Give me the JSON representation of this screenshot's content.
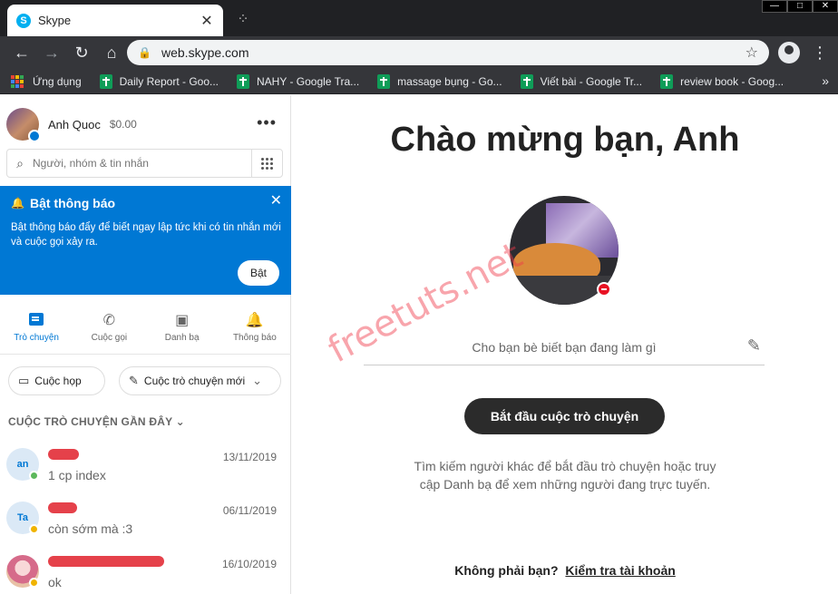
{
  "browser": {
    "tab_title": "Skype",
    "tab_favicon_letter": "S",
    "url": "web.skype.com",
    "bookmarks": [
      {
        "label": "Ứng dụng",
        "icon": "apps-grid-icon"
      },
      {
        "label": "Daily Report - Goo...",
        "icon": "google-sheets-icon"
      },
      {
        "label": "NAHY - Google Tra...",
        "icon": "google-sheets-icon"
      },
      {
        "label": "massage bụng - Go...",
        "icon": "google-sheets-icon"
      },
      {
        "label": "Viết bài - Google Tr...",
        "icon": "google-sheets-icon"
      },
      {
        "label": "review book - Goog...",
        "icon": "google-sheets-icon"
      }
    ],
    "bookmarks_more": "»"
  },
  "sidebar": {
    "profile": {
      "name": "Anh Quoc",
      "credit": "$0.00"
    },
    "search_placeholder": "Người, nhóm & tin nhắn",
    "notification": {
      "title": "Bật thông báo",
      "body": "Bật thông báo đẩy để biết ngay lập tức khi có tin nhắn mới và cuộc gọi xảy ra.",
      "button": "Bật"
    },
    "tabs": [
      {
        "label": "Trò chuyện",
        "icon": "chat-icon",
        "active": true
      },
      {
        "label": "Cuộc gọi",
        "icon": "phone-icon",
        "active": false
      },
      {
        "label": "Danh bạ",
        "icon": "contacts-icon",
        "active": false
      },
      {
        "label": "Thông báo",
        "icon": "bell-icon",
        "active": false
      }
    ],
    "meet_button": "Cuộc họp",
    "new_chat_button": "Cuộc trò chuyện mới",
    "recent_title": "CUỘC TRÒ CHUYỆN GẦN ĐÂY",
    "chats": [
      {
        "initials": "an",
        "message": "1 cp index",
        "date": "13/11/2019",
        "status_color": "#5cb85c"
      },
      {
        "initials": "Ta",
        "message": "còn sớm mà :3",
        "date": "06/11/2019",
        "status_color": "#f0b400"
      },
      {
        "initials": "",
        "message": "ok",
        "date": "16/10/2019",
        "status_color": "#f0b400"
      }
    ]
  },
  "main": {
    "welcome": "Chào mừng bạn, Anh",
    "mood_placeholder": "Cho bạn bè biết bạn đang làm gì",
    "start_button": "Bắt đầu cuộc trò chuyện",
    "hint": "Tìm kiếm người khác để bắt đầu trò chuyện hoặc truy cập Danh bạ để xem những người đang trực tuyến.",
    "not_you": "Không phải bạn?",
    "check_account": "Kiểm tra tài khoản",
    "watermark": "freetuts.net"
  },
  "colors": {
    "accent": "#0078d4",
    "dark_button": "#2b2b2b",
    "watermark": "#f03a4a"
  }
}
